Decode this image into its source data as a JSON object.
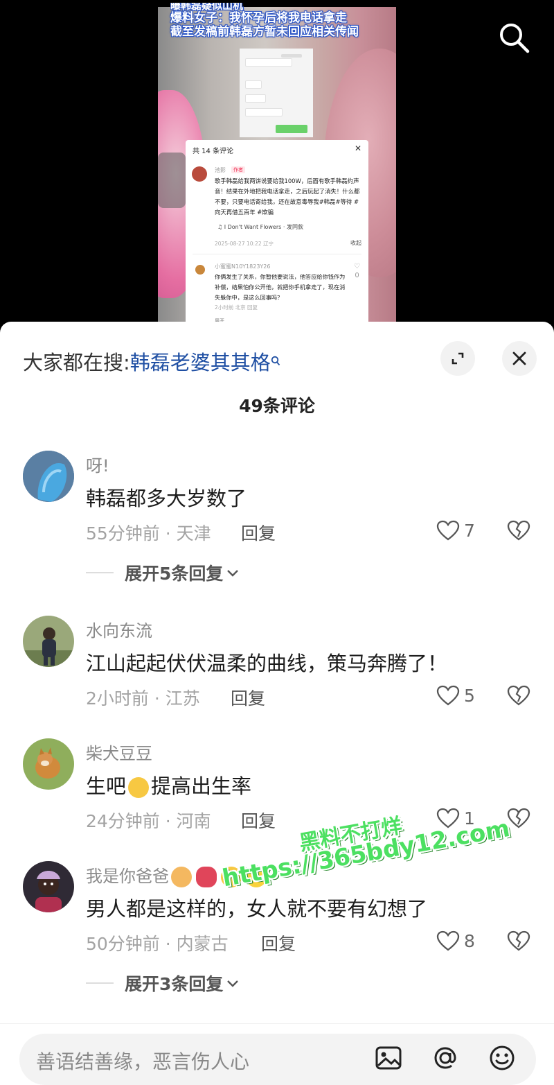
{
  "video": {
    "headline": [
      "曝韩磊疑似山机",
      "爆料女子：我怀孕后将我电话拿走",
      "截至发稿前韩磊方暂未回应相关传闻"
    ],
    "embedded_screenshot": {
      "header": "共 14 条评论",
      "comment1": {
        "name": "池影",
        "tag": "作者",
        "text": "歌手韩磊给我两饼说要给我100W，后面有歌手韩磊约声音！结果在外地把我电话拿走，之后玩起了消失！什么都不要，只要电话寄给我，还在故意毒辱我#韩磊#等待 #向天再借五百年 #欺骗",
        "song": "♫ I Don't Want Flowers · 发同款",
        "time": "2025-08-27 10:22 辽宁",
        "fold": "收起"
      },
      "comment2": {
        "name": "小蜜蜜N10Y1823Y26",
        "text": "你俩发生了关系，你暂他要说法，他答应给你钱作为补偿，结果怕你公开他，就把你手机拿走了，现在消失躲你中，是这么回事吗？",
        "time": "2小时前 北京 回复",
        "likes": "0",
        "more": "展开"
      }
    }
  },
  "sheet": {
    "suggest_prefix": "大家都在搜:",
    "suggest_keyword": "韩磊老婆其其格",
    "comment_count": "49条评论",
    "reply_label": "回复",
    "comments": [
      {
        "name": "呀!",
        "text": "韩磊都多大岁数了",
        "meta": "55分钟前 · 天津",
        "likes": "7",
        "expand": "展开5条回复",
        "avatar_color": "#4aa8e0"
      },
      {
        "name": "水向东流",
        "text": "江山起起伏伏温柔的曲线，策马奔腾了！",
        "meta": "2小时前 · 江苏",
        "likes": "5",
        "avatar_color": "#6f8a55"
      },
      {
        "name": "柴犬豆豆",
        "text_a": "生吧",
        "text_b": "提高出生率",
        "meta": "24分钟前 · 河南",
        "likes": "1",
        "avatar_color": "#8fae5c"
      },
      {
        "name": "我是你爸爸",
        "text": "男人都是这样的，女人就不要有幻想了",
        "meta": "50分钟前 · 内蒙古",
        "likes": "8",
        "expand": "展开3条回复",
        "avatar_color": "#3a3040"
      }
    ],
    "input_placeholder": "善语结善缘，恶言伤人心"
  },
  "watermark": {
    "line1": "黑料不打烊",
    "line2": "https://365bdy12.com"
  },
  "colors": {
    "keyword": "#1f4fa3",
    "watermark": "#4ce061",
    "headline_stroke": "#2b55c7"
  }
}
